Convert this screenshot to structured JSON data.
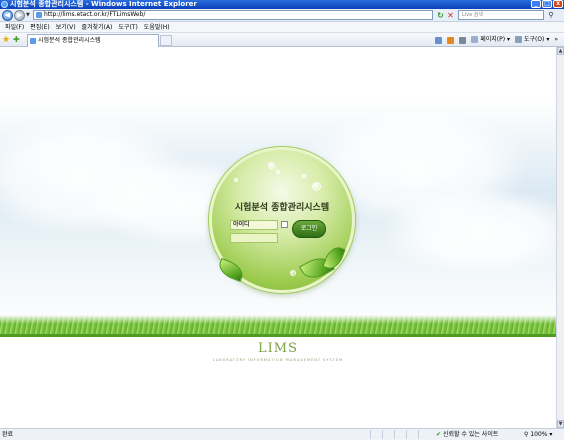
{
  "window": {
    "title": "시험분석 종합관리시스템 - Windows Internet Explorer",
    "buttons": {
      "minimize": "_",
      "maximize": "□",
      "close": "x"
    }
  },
  "address_bar": {
    "url": "http://lims.etact.or.kr/FTLimsWeb/",
    "search_placeholder": "Live 검색",
    "back_icon": "back-arrow-icon",
    "forward_icon": "forward-arrow-icon"
  },
  "menu": {
    "items": [
      "파일(F)",
      "편집(E)",
      "보기(V)",
      "즐겨찾기(A)",
      "도구(T)",
      "도움말(H)"
    ]
  },
  "tabs": {
    "active_tab": "시험분석 종합관리시스템"
  },
  "command_bar": {
    "page_label": "페이지(P)",
    "tools_label": "도구(O)"
  },
  "login": {
    "system_title": "시험분석 종합관리시스템",
    "id_value": "아이디",
    "password_value": "",
    "login_button": "로그인"
  },
  "branding": {
    "logo": "LIMS",
    "tagline": "LABORATORY INFORMATION MANAGEMENT SYSTEM"
  },
  "status_bar": {
    "status": "완료",
    "zone": "신뢰할 수 있는 사이트",
    "zoom": "100%"
  },
  "colors": {
    "titlebar": "#0a3fb8",
    "accent_green": "#6fae2e",
    "login_button": "#2f6e16"
  }
}
